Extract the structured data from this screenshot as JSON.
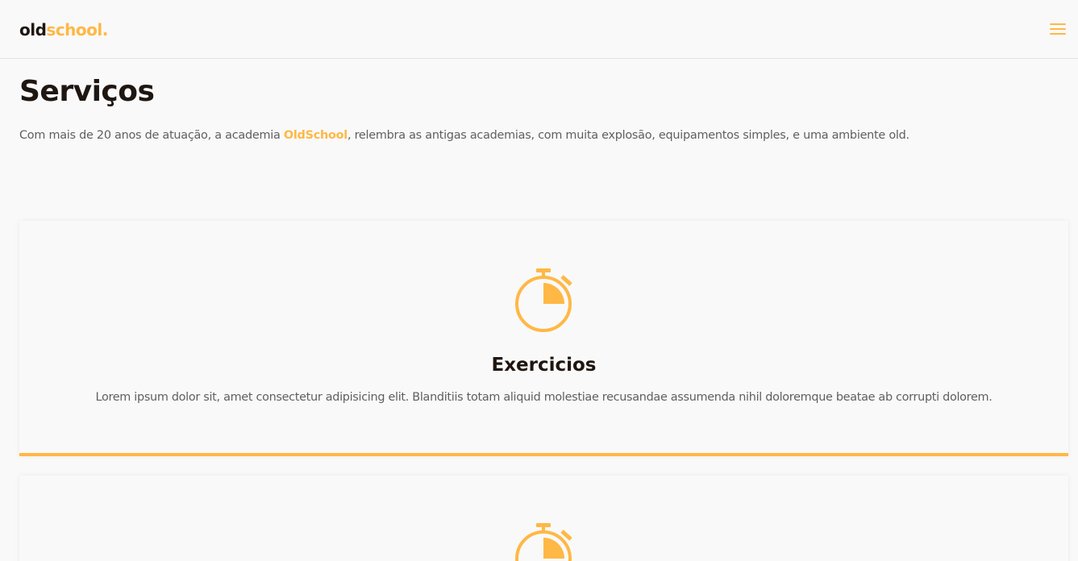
{
  "header": {
    "logo_part1": "old",
    "logo_part2": "school.",
    "menu_icon": "hamburger-menu-icon"
  },
  "section": {
    "title": "Serviços",
    "intro_before": "Com mais de 20 anos de atuação, a academia ",
    "intro_highlight": "OldSchool",
    "intro_after": ", relembra as antigas academias, com muita explosão, equipamentos simples, e uma ambiente old."
  },
  "cards": [
    {
      "icon": "stopwatch-icon",
      "title": "Exercicios",
      "text": "Lorem ipsum dolor sit, amet consectetur adipisicing elit. Blanditiis totam aliquid molestiae recusandae assumenda nihil doloremque beatae ab corrupti dolorem."
    },
    {
      "icon": "stopwatch-icon"
    }
  ],
  "colors": {
    "accent": "#ffb845",
    "dark": "#1e1611",
    "text": "#5f5f5f",
    "background": "#f9f9f9"
  }
}
